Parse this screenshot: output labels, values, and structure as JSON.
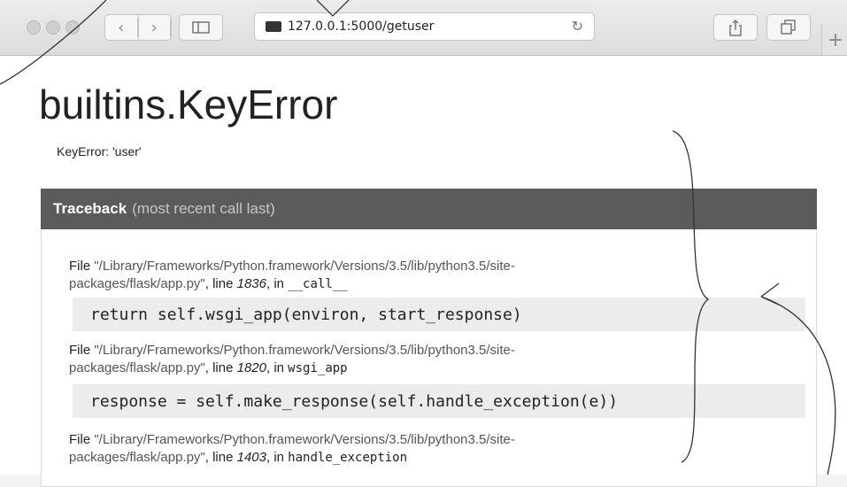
{
  "browser": {
    "url": "127.0.0.1:5000/getuser",
    "back_icon": "chevron-left-icon",
    "forward_icon": "chevron-right-icon"
  },
  "page": {
    "title": "builtins.KeyError",
    "error_message": "KeyError: 'user'",
    "traceback_header": "Traceback",
    "traceback_note": "(most recent call last)",
    "frames": [
      {
        "file_label": "File",
        "path_line1": "\"/Library/Frameworks/Python.framework/Versions/3.5/lib/python3.5/site-",
        "path_line2": "packages/flask/app.py\"",
        "line_label": ", line",
        "line_no": "1836",
        "in_label": ", in",
        "func": "__call__",
        "code": "return self.wsgi_app(environ, start_response)"
      },
      {
        "file_label": "File",
        "path_line1": "\"/Library/Frameworks/Python.framework/Versions/3.5/lib/python3.5/site-",
        "path_line2": "packages/flask/app.py\"",
        "line_label": ", line",
        "line_no": "1820",
        "in_label": ", in",
        "func": "wsgi_app",
        "code": "response = self.make_response(self.handle_exception(e))"
      },
      {
        "file_label": "File",
        "path_line1": "\"/Library/Frameworks/Python.framework/Versions/3.5/lib/python3.5/site-",
        "path_line2": "packages/flask/app.py\"",
        "line_label": ", line",
        "line_no": "1403",
        "in_label": ", in",
        "func": "handle_exception"
      }
    ]
  }
}
